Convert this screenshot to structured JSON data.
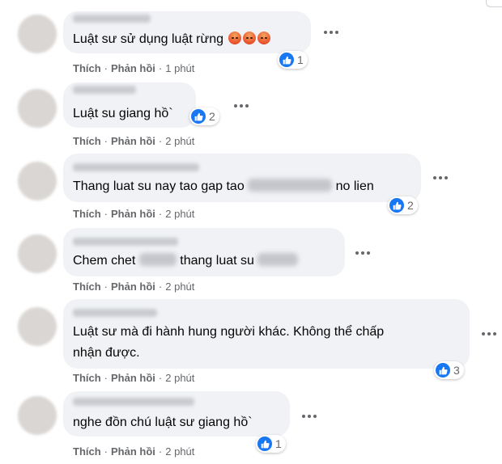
{
  "comments": [
    {
      "text": "Luật sư sử dụng luật rừng",
      "emoji_count": 3,
      "likes": "1",
      "like": "Thích",
      "reply": "Phản hồi",
      "time": "1 phút"
    },
    {
      "text": "Luật su giang hồ`",
      "likes": "2",
      "like": "Thích",
      "reply": "Phản hồi",
      "time": "2 phút"
    },
    {
      "text_before": "Thang luat su nay tao gap tao",
      "text_after": "no lien",
      "likes": "2",
      "like": "Thích",
      "reply": "Phản hồi",
      "time": "2 phút"
    },
    {
      "text_before": "Chem chet",
      "text_middle": "thang luat su",
      "likes": "",
      "like": "Thích",
      "reply": "Phản hồi",
      "time": "2 phút"
    },
    {
      "line1": "Luật sư mà đi hành hung người khác. Không thể chấp",
      "line2": "nhận được.",
      "likes": "3",
      "like": "Thích",
      "reply": "Phản hồi",
      "time": "2 phút"
    },
    {
      "text": "nghe đồn chú luật sư giang hồ`",
      "likes": "1",
      "like": "Thích",
      "reply": "Phản hồi",
      "time": "2 phút"
    }
  ],
  "sep": "·",
  "colors": {
    "bubble": "#f0f2f5",
    "like_blue": "#1877f2",
    "meta": "#65676b"
  },
  "icons": {
    "like": "thumbs-up-icon",
    "angry": "angry-face-icon",
    "more": "more-options-icon"
  }
}
